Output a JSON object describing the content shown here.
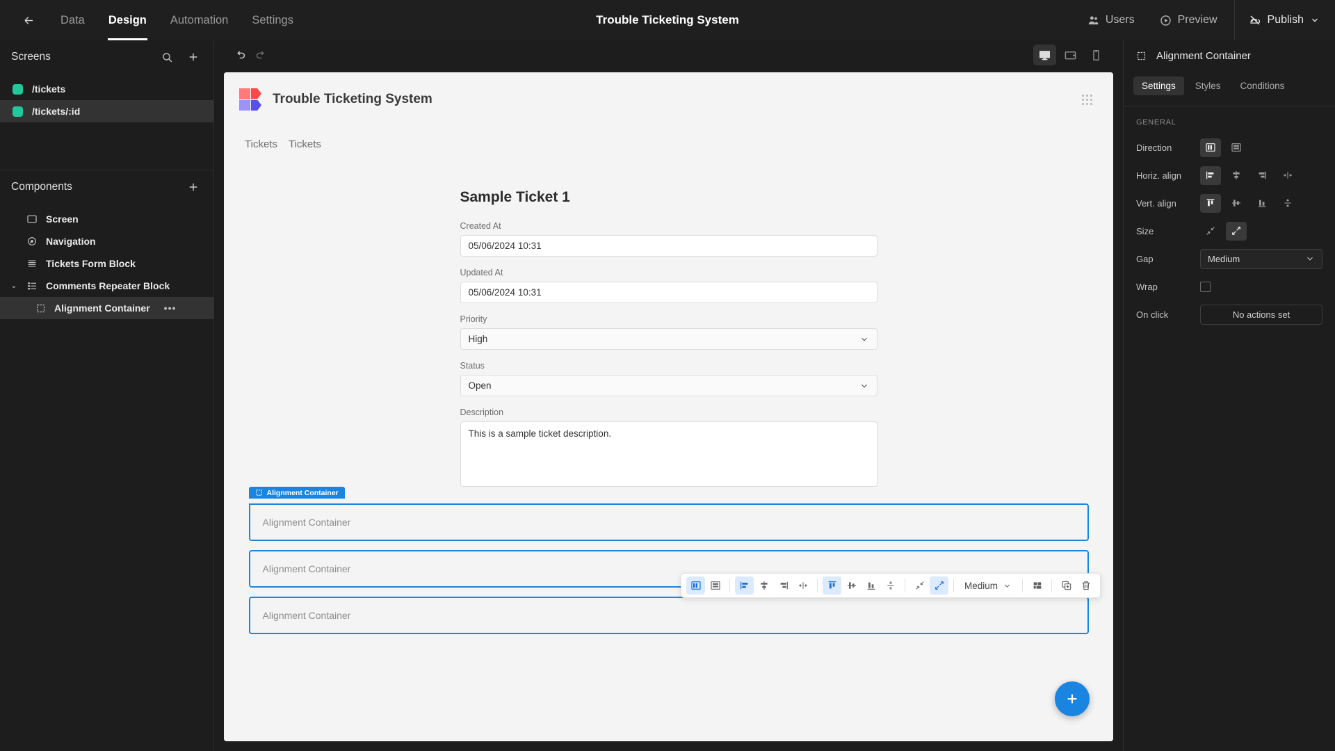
{
  "topbar": {
    "back_icon": "arrow-left-icon",
    "nav": [
      {
        "label": "Data",
        "active": false
      },
      {
        "label": "Design",
        "active": true
      },
      {
        "label": "Automation",
        "active": false
      },
      {
        "label": "Settings",
        "active": false
      }
    ],
    "app_title": "Trouble Ticketing System",
    "users_label": "Users",
    "preview_label": "Preview",
    "publish_label": "Publish"
  },
  "left_panel": {
    "screens": {
      "title": "Screens",
      "search_icon": "search-icon",
      "add_icon": "plus-icon",
      "items": [
        {
          "label": "/tickets",
          "selected": false,
          "color": "#22c79a"
        },
        {
          "label": "/tickets/:id",
          "selected": true,
          "color": "#22c79a"
        }
      ]
    },
    "components": {
      "title": "Components",
      "add_icon": "plus-icon",
      "items": [
        {
          "label": "Screen",
          "icon": "screen-icon",
          "selected": false,
          "indent": false,
          "caret": false
        },
        {
          "label": "Navigation",
          "icon": "navigation-icon",
          "selected": false,
          "indent": false,
          "caret": false
        },
        {
          "label": "Tickets Form Block",
          "icon": "form-block-icon",
          "selected": false,
          "indent": false,
          "caret": false
        },
        {
          "label": "Comments Repeater Block",
          "icon": "repeater-icon",
          "selected": false,
          "indent": false,
          "caret": true
        },
        {
          "label": "Alignment Container",
          "icon": "alignment-container-icon",
          "selected": true,
          "indent": true,
          "caret": false,
          "menu": "•••"
        }
      ]
    }
  },
  "canvas_toolbar": {
    "undo_icon": "undo-icon",
    "redo_icon": "redo-icon",
    "devices": [
      {
        "name": "desktop-icon",
        "active": true
      },
      {
        "name": "tablet-icon",
        "active": false
      },
      {
        "name": "mobile-icon",
        "active": false
      }
    ]
  },
  "preview_app": {
    "logo_icon": "budibase-logo-icon",
    "name": "Trouble Ticketing System",
    "grid_handle_icon": "drag-handle-icon",
    "nav_links": [
      "Tickets",
      "Tickets"
    ],
    "form": {
      "title": "Sample Ticket 1",
      "fields": [
        {
          "label": "Created At",
          "value": "05/06/2024 10:31",
          "type": "input"
        },
        {
          "label": "Updated At",
          "value": "05/06/2024 10:31",
          "type": "input"
        },
        {
          "label": "Priority",
          "value": "High",
          "type": "select"
        },
        {
          "label": "Status",
          "value": "Open",
          "type": "select"
        },
        {
          "label": "Description",
          "value": "This is a sample ticket description.",
          "type": "textarea"
        }
      ]
    },
    "selection_badge": "Alignment Container",
    "containers": [
      {
        "label": "Alignment Container"
      },
      {
        "label": "Alignment Container"
      },
      {
        "label": "Alignment Container"
      }
    ],
    "fab_icon": "plus-icon",
    "accent_color": "#1a85e0"
  },
  "float_toolbar": {
    "gap_value": "Medium",
    "buttons": [
      {
        "name": "direction-horizontal-icon",
        "active": true
      },
      {
        "name": "direction-vertical-icon",
        "active": false
      },
      {
        "name": "align-left-icon",
        "active": true
      },
      {
        "name": "align-center-icon",
        "active": false
      },
      {
        "name": "align-right-icon",
        "active": false
      },
      {
        "name": "align-space-icon",
        "active": false
      },
      {
        "name": "valign-top-icon",
        "active": true
      },
      {
        "name": "valign-middle-icon",
        "active": false
      },
      {
        "name": "valign-bottom-icon",
        "active": false
      },
      {
        "name": "valign-stretch-icon",
        "active": false
      },
      {
        "name": "size-shrink-icon",
        "active": false
      },
      {
        "name": "size-grow-icon",
        "active": true
      },
      {
        "name": "layout-icon",
        "active": false
      },
      {
        "name": "duplicate-icon",
        "active": false
      },
      {
        "name": "delete-icon",
        "active": false
      }
    ]
  },
  "right_panel": {
    "component_icon": "alignment-container-icon",
    "component_name": "Alignment Container",
    "tabs": [
      {
        "label": "Settings",
        "active": true
      },
      {
        "label": "Styles",
        "active": false
      },
      {
        "label": "Conditions",
        "active": false
      }
    ],
    "section_title": "GENERAL",
    "rows": {
      "direction": {
        "label": "Direction",
        "options": [
          "direction-horizontal-icon",
          "direction-vertical-icon"
        ],
        "active_index": 0
      },
      "horiz_align": {
        "label": "Horiz. align",
        "options": [
          "align-left-icon",
          "align-center-icon",
          "align-right-icon",
          "align-space-icon"
        ],
        "active_index": 0
      },
      "vert_align": {
        "label": "Vert. align",
        "options": [
          "valign-top-icon",
          "valign-middle-icon",
          "valign-bottom-icon",
          "valign-stretch-icon"
        ],
        "active_index": 0
      },
      "size": {
        "label": "Size",
        "options": [
          "size-shrink-icon",
          "size-grow-icon"
        ],
        "active_index": 1
      },
      "gap": {
        "label": "Gap",
        "value": "Medium"
      },
      "wrap": {
        "label": "Wrap",
        "checked": false
      },
      "on_click": {
        "label": "On click",
        "value": "No actions set"
      }
    }
  }
}
